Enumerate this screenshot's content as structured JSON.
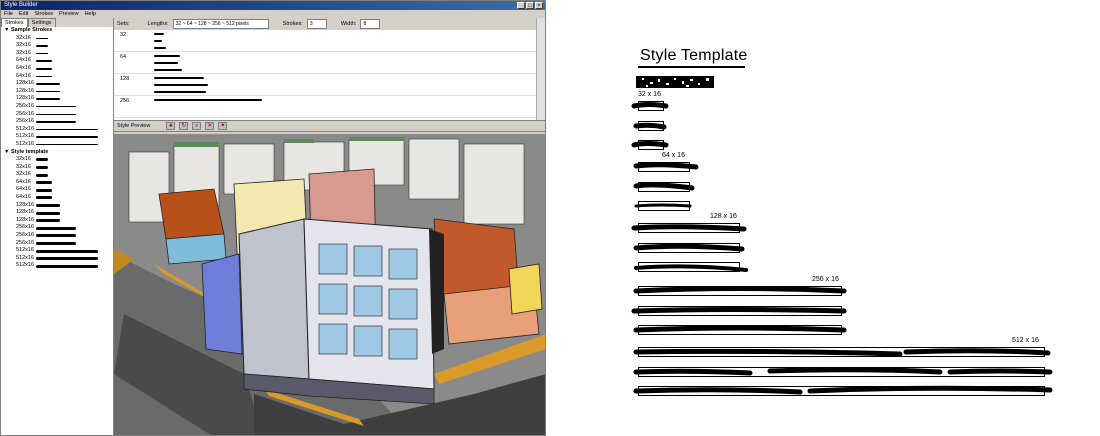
{
  "window": {
    "title": "Style Builder",
    "menu": [
      "File",
      "Edit",
      "Strokes",
      "Preview",
      "Help"
    ],
    "tabs": [
      "Strokes",
      "Settings"
    ]
  },
  "tree": {
    "sample_group": "Sample Strokes",
    "sample_items": [
      "32x16",
      "32x16",
      "32x16",
      "64x16",
      "64x16",
      "64x16",
      "128x16",
      "128x16",
      "128x16",
      "256x16",
      "256x16",
      "256x16",
      "512x16",
      "512x16",
      "512x16"
    ],
    "template_group": "Style template",
    "template_items": [
      "32x16",
      "32x16",
      "32x16",
      "64x16",
      "64x16",
      "64x16",
      "128x16",
      "128x16",
      "128x16",
      "256x16",
      "256x16",
      "256x16",
      "512x16",
      "512x16",
      "512x16"
    ]
  },
  "sets_bar": {
    "sets_label": "Sets:",
    "lengths_label": "Lengths:",
    "lengths_value": "32 ~ 64 ~ 128 ~ 256 ~ 512 pixels",
    "strokes_label": "Strokes:",
    "strokes_value": "3",
    "width_label": "Width:",
    "width_value": "8"
  },
  "sets": [
    {
      "label": "32",
      "widths": [
        10,
        8,
        12
      ]
    },
    {
      "label": "64",
      "widths": [
        26,
        24,
        28
      ]
    },
    {
      "label": "128",
      "widths": [
        50,
        54,
        52
      ]
    },
    {
      "label": "256",
      "widths": [
        108,
        0,
        0
      ]
    }
  ],
  "preview": {
    "label": "Style Preview"
  },
  "template": {
    "title": "Style Template",
    "labels": [
      "32 x 16",
      "64 x 16",
      "128 x 16",
      "256 x 16",
      "512 x 16"
    ]
  }
}
